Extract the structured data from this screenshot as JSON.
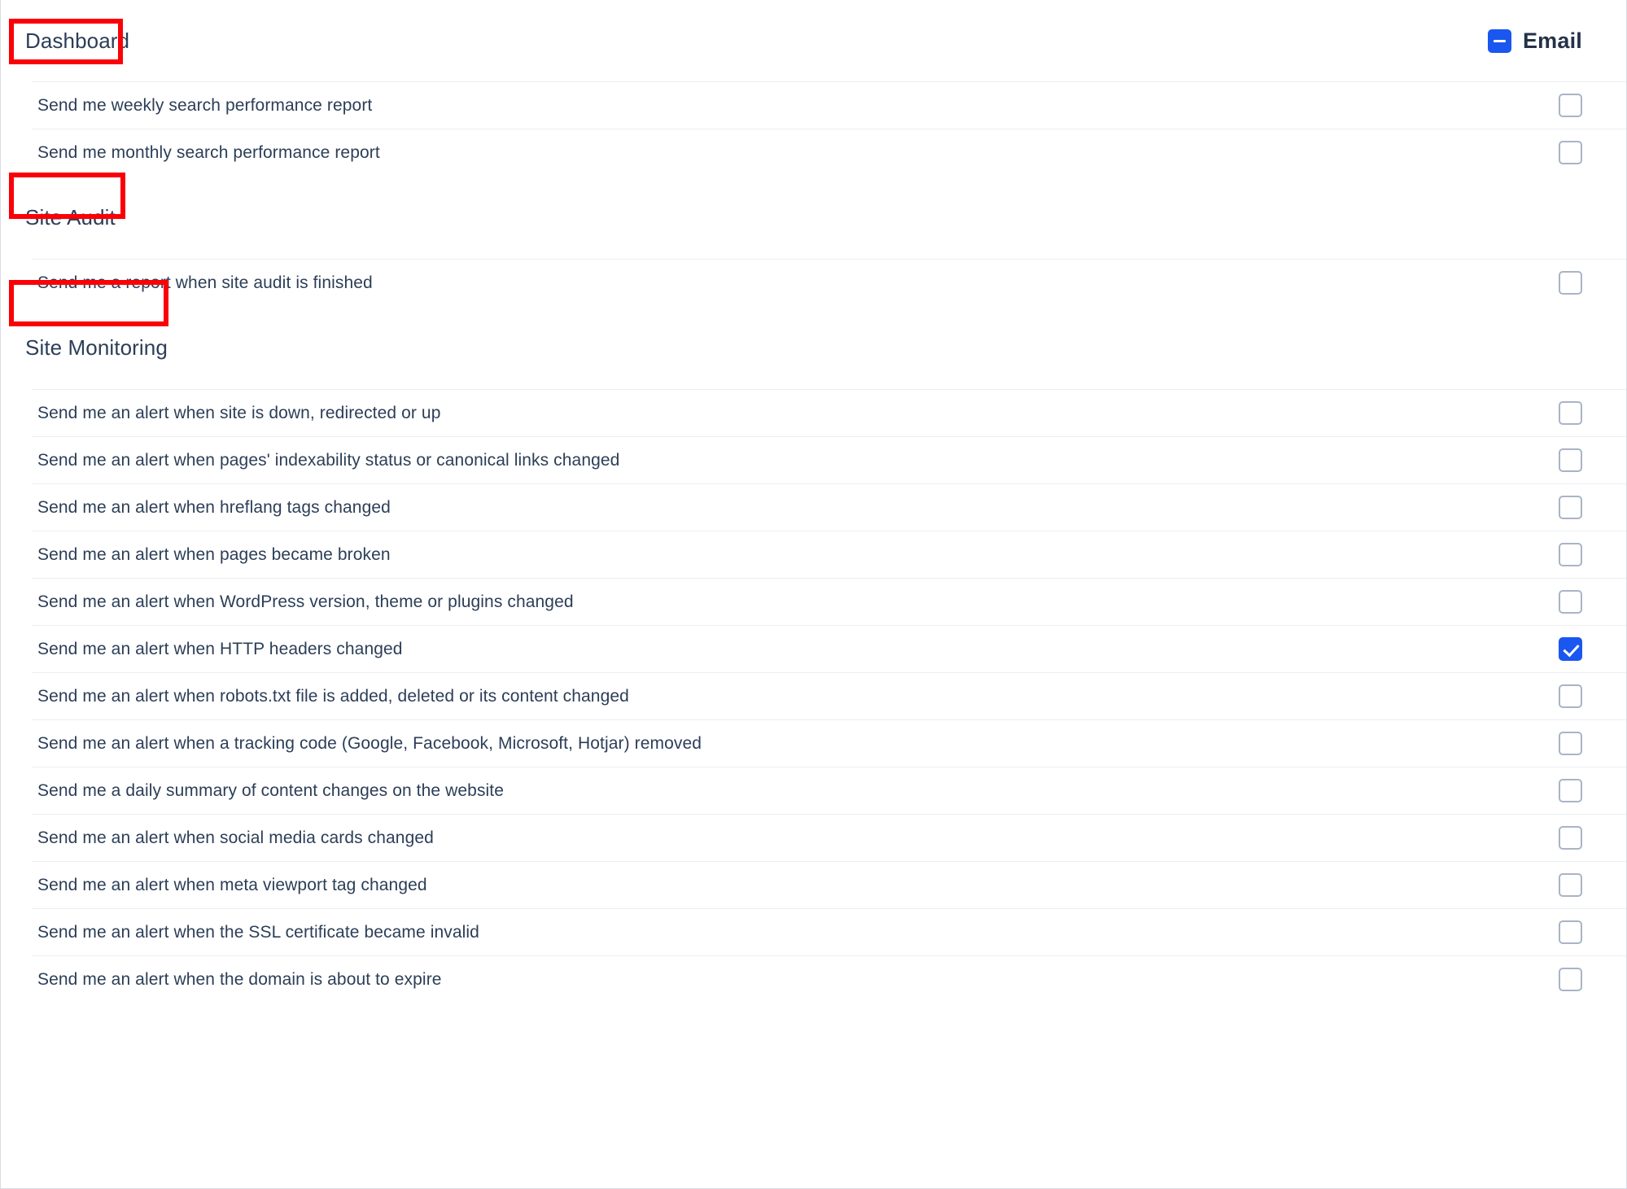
{
  "header": {
    "title": "Dashboard",
    "email_label": "Email",
    "email_checkbox_state": "indeterminate"
  },
  "colors": {
    "accent": "#1a56f0",
    "text": "#2c3e57",
    "annotation": "#fb0007",
    "row_divider": "#eceef2",
    "checkbox_border": "#a9b4c6"
  },
  "annotations": [
    {
      "target": "Dashboard"
    },
    {
      "target": "Site Audit"
    },
    {
      "target": "Site Monitoring"
    }
  ],
  "sections": [
    {
      "title": "Dashboard",
      "rows": [
        {
          "label": "Send me weekly search performance report",
          "checked": false
        },
        {
          "label": "Send me monthly search performance report",
          "checked": false
        }
      ]
    },
    {
      "title": "Site Audit",
      "rows": [
        {
          "label": "Send me a report when site audit is finished",
          "checked": false
        }
      ]
    },
    {
      "title": "Site Monitoring",
      "rows": [
        {
          "label": "Send me an alert when site is down, redirected or up",
          "checked": false
        },
        {
          "label": "Send me an alert when pages' indexability status or canonical links changed",
          "checked": false
        },
        {
          "label": "Send me an alert when hreflang tags changed",
          "checked": false
        },
        {
          "label": "Send me an alert when pages became broken",
          "checked": false
        },
        {
          "label": "Send me an alert when WordPress version, theme or plugins changed",
          "checked": false
        },
        {
          "label": "Send me an alert when HTTP headers changed",
          "checked": true
        },
        {
          "label": "Send me an alert when robots.txt file is added, deleted or its content changed",
          "checked": false
        },
        {
          "label": "Send me an alert when a tracking code (Google, Facebook, Microsoft, Hotjar) removed",
          "checked": false
        },
        {
          "label": "Send me a daily summary of content changes on the website",
          "checked": false
        },
        {
          "label": "Send me an alert when social media cards changed",
          "checked": false
        },
        {
          "label": "Send me an alert when meta viewport tag changed",
          "checked": false
        },
        {
          "label": "Send me an alert when the SSL certificate became invalid",
          "checked": false
        },
        {
          "label": "Send me an alert when the domain is about to expire",
          "checked": false
        }
      ]
    }
  ]
}
